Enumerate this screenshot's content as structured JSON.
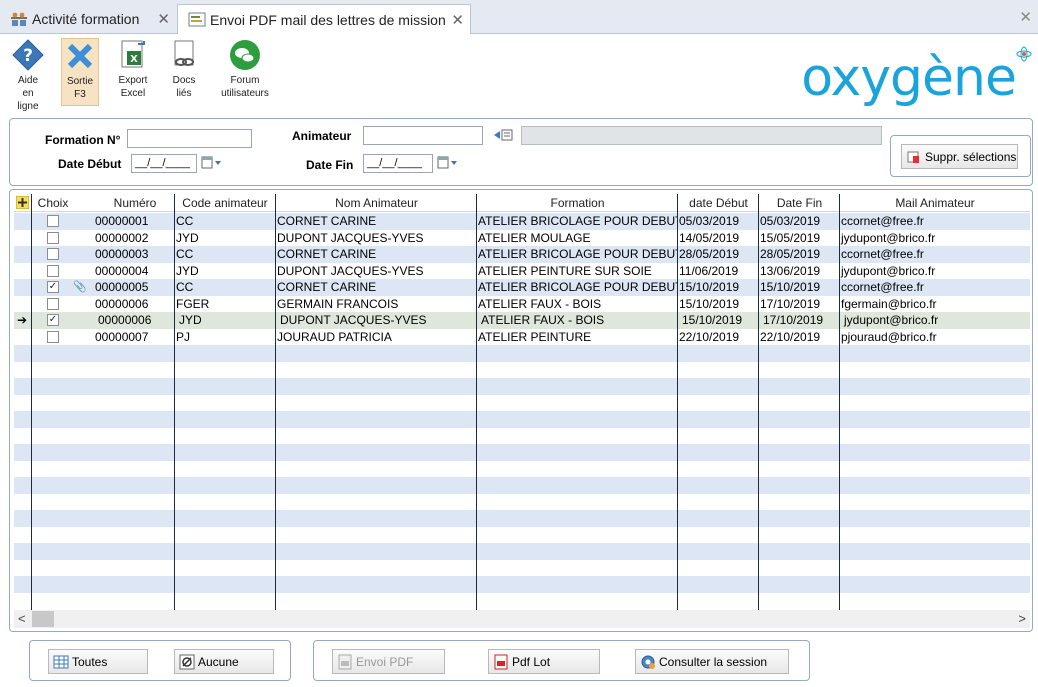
{
  "tabs": [
    {
      "label": "Activité formation"
    },
    {
      "label": "Envoi PDF mail des lettres de mission"
    }
  ],
  "toolbar": {
    "help_label_1": "Aide",
    "help_label_2": "en",
    "help_label_3": "ligne",
    "exit_label_1": "Sortie",
    "exit_label_2": "F3",
    "export_label_1": "Export",
    "export_label_2": "Excel",
    "docs_label_1": "Docs",
    "docs_label_2": "liés",
    "forum_label_1": "Forum",
    "forum_label_2": "utilisateurs"
  },
  "logo": {
    "text": "oxygène",
    "color": "#1ba3dc"
  },
  "filter": {
    "formation_label": "Formation N°",
    "formation_value": "",
    "date_debut_label": "Date Début",
    "date_debut_value": "__/__/____",
    "animateur_label": "Animateur",
    "animateur_value": "",
    "animateur_name_value": "",
    "date_fin_label": "Date Fin",
    "date_fin_value": "__/__/____",
    "suppr_label": "Suppr. sélections"
  },
  "grid": {
    "columns": [
      "Choix",
      "Numéro",
      "Code animateur",
      "Nom Animateur",
      "Formation",
      "date Début",
      "Date Fin",
      "Mail Animateur"
    ],
    "rows": [
      {
        "checked": false,
        "attach": false,
        "current": false,
        "numero": "00000001",
        "code": "CC",
        "nom": "CORNET CARINE",
        "formation": "ATELIER BRICOLAGE POUR DEBUT",
        "debut": "05/03/2019",
        "fin": "05/03/2019",
        "mail": "ccornet@free.fr"
      },
      {
        "checked": false,
        "attach": false,
        "current": false,
        "numero": "00000002",
        "code": "JYD",
        "nom": "DUPONT JACQUES-YVES",
        "formation": "ATELIER MOULAGE",
        "debut": "14/05/2019",
        "fin": "15/05/2019",
        "mail": "jydupont@brico.fr"
      },
      {
        "checked": false,
        "attach": false,
        "current": false,
        "numero": "00000003",
        "code": "CC",
        "nom": "CORNET CARINE",
        "formation": "ATELIER BRICOLAGE POUR DEBUT",
        "debut": "28/05/2019",
        "fin": "28/05/2019",
        "mail": "ccornet@free.fr"
      },
      {
        "checked": false,
        "attach": false,
        "current": false,
        "numero": "00000004",
        "code": "JYD",
        "nom": "DUPONT JACQUES-YVES",
        "formation": "ATELIER PEINTURE SUR SOIE",
        "debut": "11/06/2019",
        "fin": "13/06/2019",
        "mail": "jydupont@brico.fr"
      },
      {
        "checked": true,
        "attach": true,
        "current": false,
        "numero": "00000005",
        "code": "CC",
        "nom": "CORNET CARINE",
        "formation": "ATELIER BRICOLAGE POUR DEBUT",
        "debut": "15/10/2019",
        "fin": "15/10/2019",
        "mail": "ccornet@free.fr"
      },
      {
        "checked": false,
        "attach": false,
        "current": false,
        "numero": "00000006",
        "code": "FGER",
        "nom": "GERMAIN FRANCOIS",
        "formation": "ATELIER FAUX - BOIS",
        "debut": "15/10/2019",
        "fin": "17/10/2019",
        "mail": "fgermain@brico.fr"
      },
      {
        "checked": true,
        "attach": false,
        "current": true,
        "numero": "00000006",
        "code": "JYD",
        "nom": "DUPONT JACQUES-YVES",
        "formation": "ATELIER FAUX - BOIS",
        "debut": "15/10/2019",
        "fin": "17/10/2019",
        "mail": "jydupont@brico.fr"
      },
      {
        "checked": false,
        "attach": false,
        "current": false,
        "numero": "00000007",
        "code": "PJ",
        "nom": "JOURAUD PATRICIA",
        "formation": "ATELIER PEINTURE",
        "debut": "22/10/2019",
        "fin": "22/10/2019",
        "mail": "pjouraud@brico.fr"
      }
    ]
  },
  "bottom": {
    "toutes_label": "Toutes",
    "aucune_label": "Aucune",
    "envoi_pdf_label": "Envoi PDF",
    "pdf_lot_label": "Pdf Lot",
    "consulter_label": "Consulter la session"
  }
}
